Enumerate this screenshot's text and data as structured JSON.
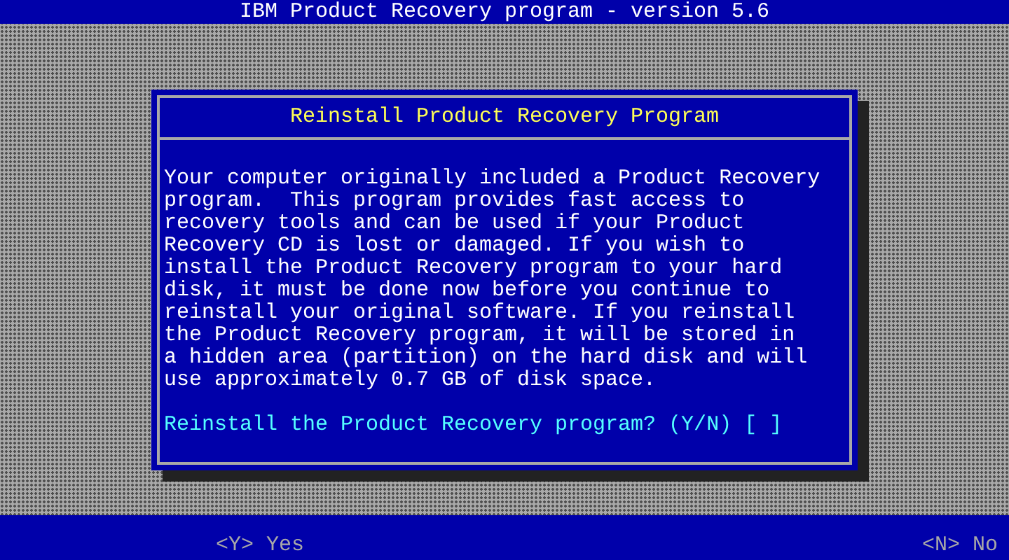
{
  "window": {
    "title": "IBM Product Recovery program - version 5.6"
  },
  "dialog": {
    "title": "Reinstall Product Recovery Program",
    "message": "Your computer originally included a Product Recovery\nprogram.  This program provides fast access to\nrecovery tools and can be used if your Product\nRecovery CD is lost or damaged. If you wish to\ninstall the Product Recovery program to your hard\ndisk, it must be done now before you continue to\nreinstall your original software. If you reinstall\nthe Product Recovery program, it will be stored in\na hidden area (partition) on the hard disk and will\nuse approximately 0.7 GB of disk space.",
    "prompt": "Reinstall the Product Recovery program? (Y/N) [ ]"
  },
  "status_bar": {
    "items": [
      {
        "label": "<Y> Yes"
      },
      {
        "label": "<N> No"
      }
    ]
  }
}
